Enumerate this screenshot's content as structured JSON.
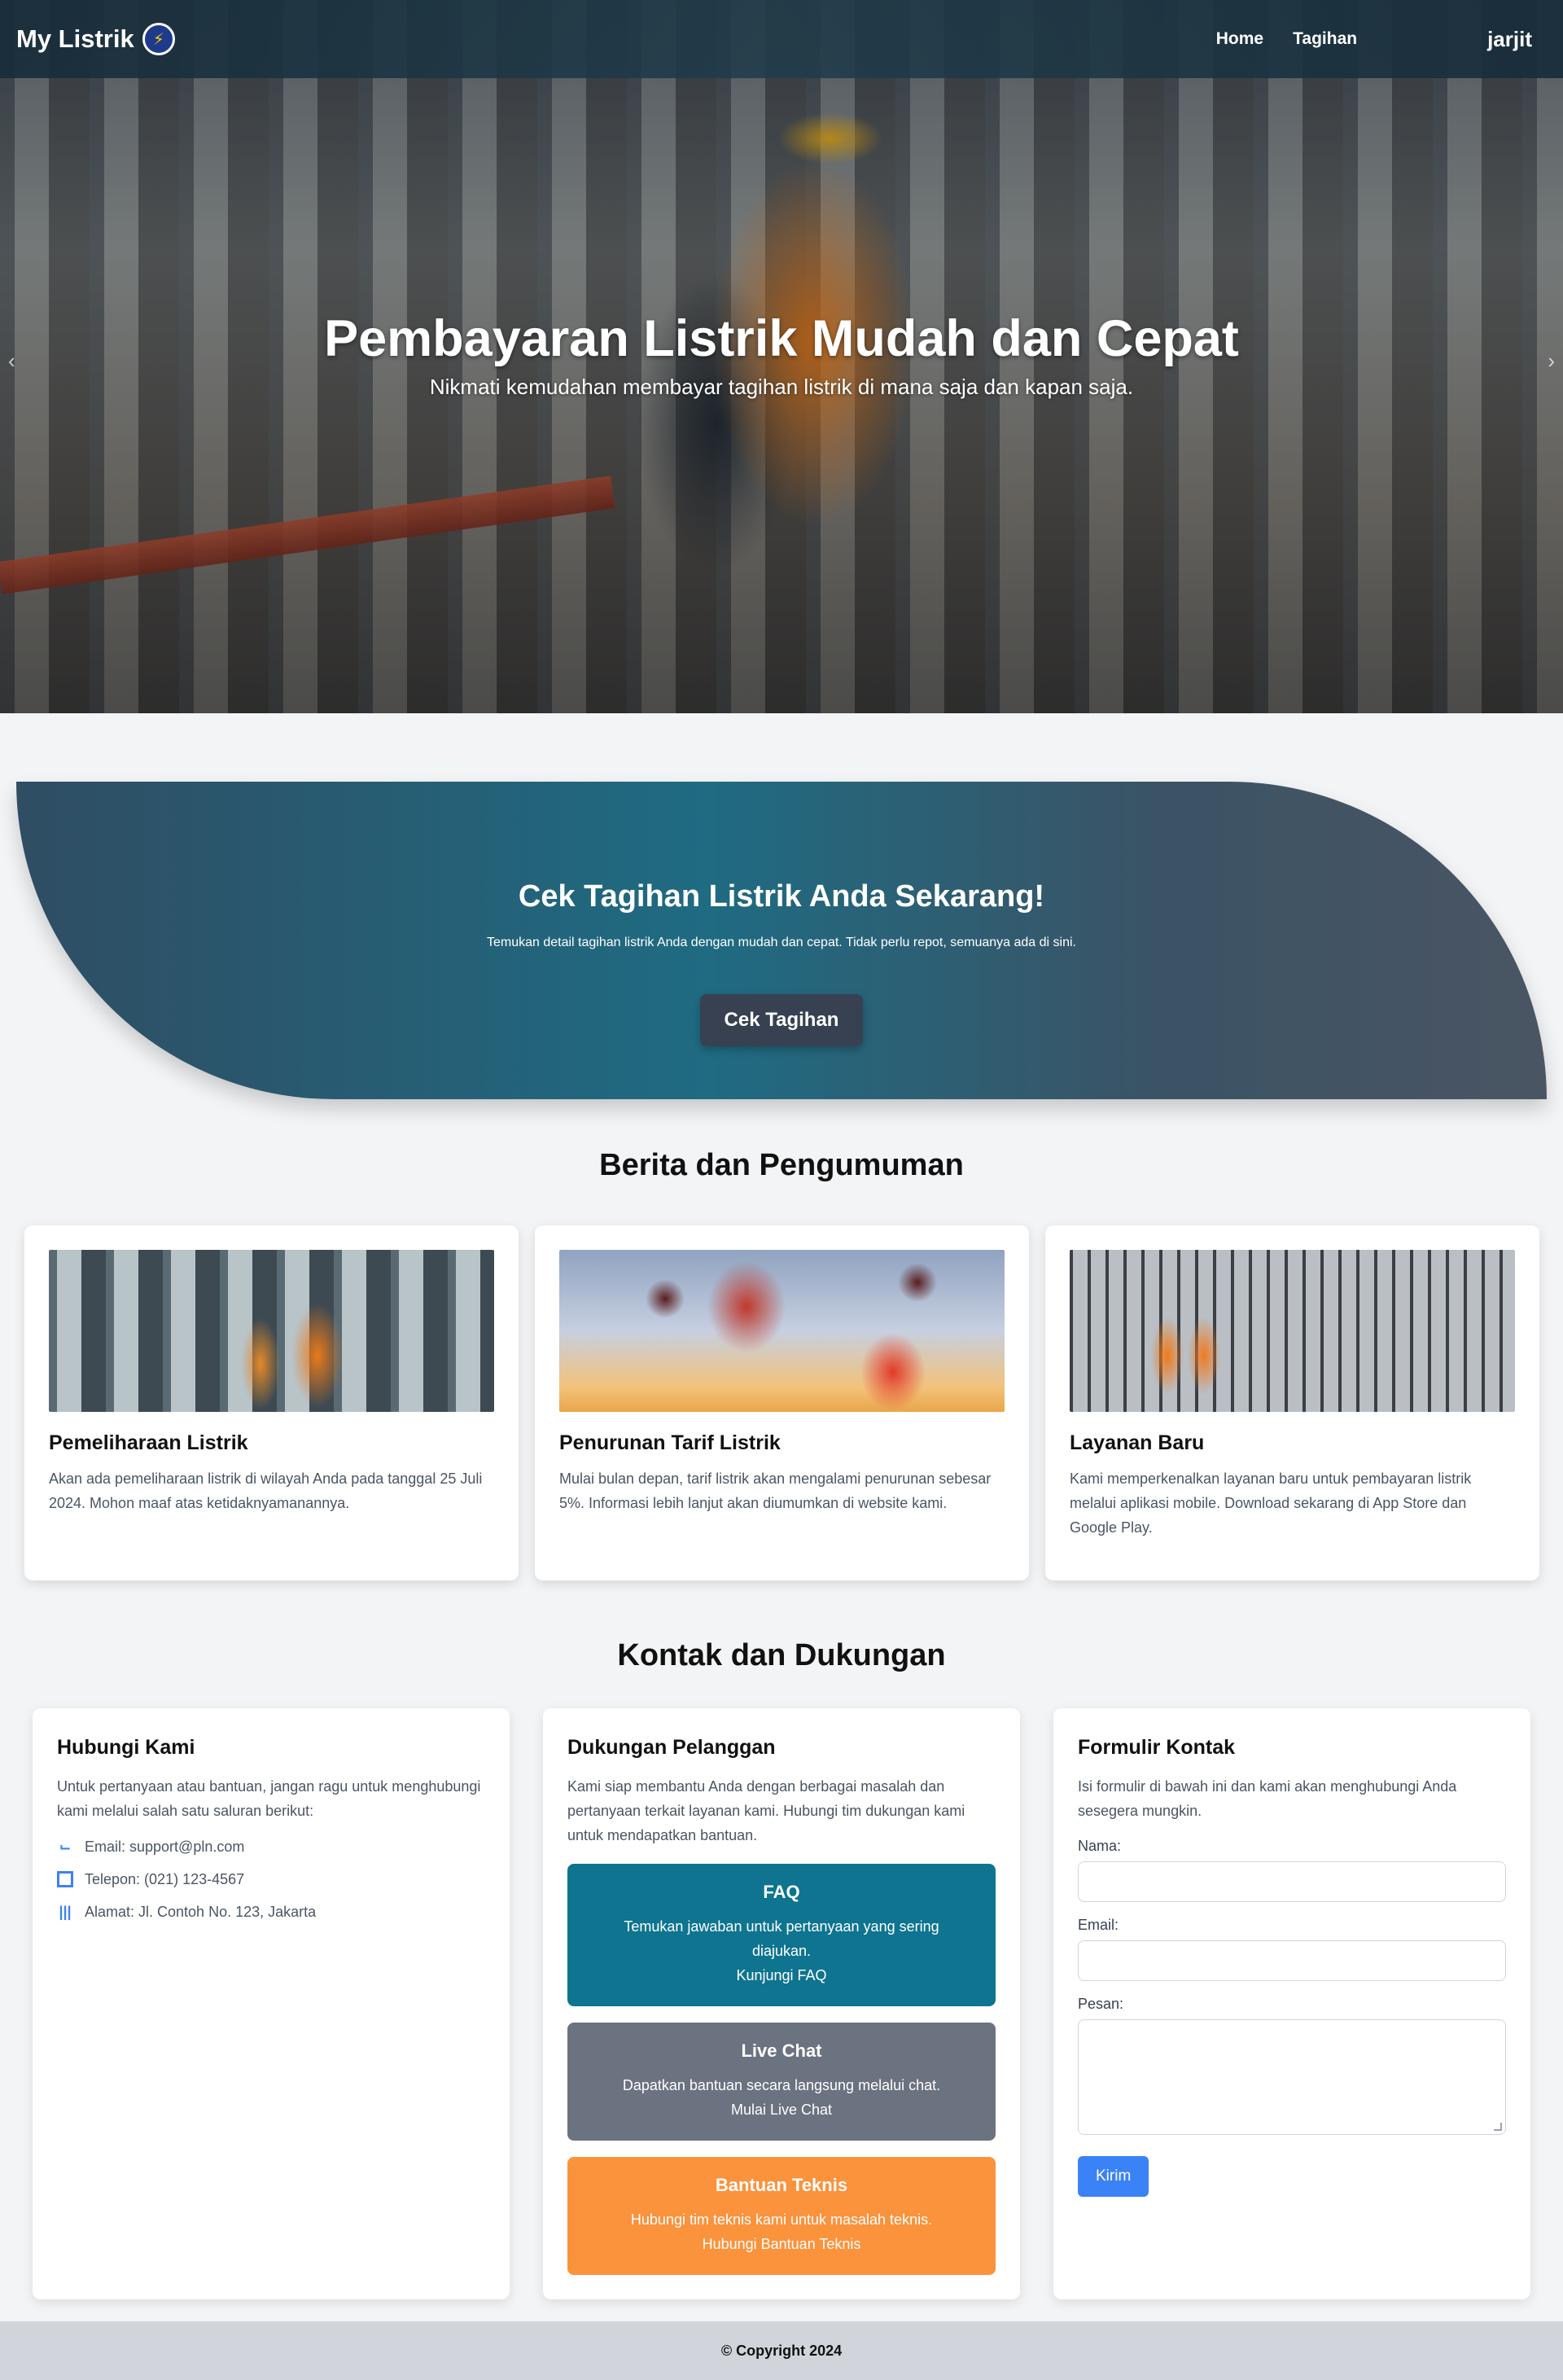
{
  "navbar": {
    "brand": "My Listrik",
    "brand_icon": "lightning-icon",
    "links": [
      {
        "label": "Home"
      },
      {
        "label": "Tagihan"
      }
    ],
    "user": "jarjit"
  },
  "hero": {
    "title": "Pembayaran Listrik Mudah dan Cepat",
    "subtitle": "Nikmati kemudahan membayar tagihan listrik di mana saja dan kapan saja.",
    "prev_icon": "‹",
    "next_icon": "›"
  },
  "cta": {
    "title": "Cek Tagihan Listrik Anda Sekarang!",
    "text": "Temukan detail tagihan listrik Anda dengan mudah dan cepat. Tidak perlu repot, semuanya ada di sini.",
    "button": "Cek Tagihan"
  },
  "news": {
    "title": "Berita dan Pengumuman",
    "items": [
      {
        "title": "Pemeliharaan Listrik",
        "text": "Akan ada pemeliharaan listrik di wilayah Anda pada tanggal 25 Juli 2024. Mohon maaf atas ketidaknyamanannya."
      },
      {
        "title": "Penurunan Tarif Listrik",
        "text": "Mulai bulan depan, tarif listrik akan mengalami penurunan sebesar 5%. Informasi lebih lanjut akan diumumkan di website kami."
      },
      {
        "title": "Layanan Baru",
        "text": "Kami memperkenalkan layanan baru untuk pembayaran listrik melalui aplikasi mobile. Download sekarang di App Store dan Google Play."
      }
    ]
  },
  "contact": {
    "title": "Kontak dan Dukungan",
    "reach": {
      "title": "Hubungi Kami",
      "text": "Untuk pertanyaan atau bantuan, jangan ragu untuk menghubungi kami melalui salah satu saluran berikut:",
      "email": "Email: support@pln.com",
      "phone": "Telepon: (021) 123-4567",
      "address": "Alamat: Jl. Contoh No. 123, Jakarta"
    },
    "support": {
      "title": "Dukungan Pelanggan",
      "text": "Kami siap membantu Anda dengan berbagai masalah dan pertanyaan terkait layanan kami. Hubungi tim dukungan kami untuk mendapatkan bantuan.",
      "faq": {
        "title": "FAQ",
        "text": "Temukan jawaban untuk pertanyaan yang sering diajukan.",
        "link": "Kunjungi FAQ"
      },
      "chat": {
        "title": "Live Chat",
        "text": "Dapatkan bantuan secara langsung melalui chat.",
        "link": "Mulai Live Chat"
      },
      "tech": {
        "title": "Bantuan Teknis",
        "text": "Hubungi tim teknis kami untuk masalah teknis.",
        "link": "Hubungi Bantuan Teknis"
      }
    },
    "form": {
      "title": "Formulir Kontak",
      "text": "Isi formulir di bawah ini dan kami akan menghubungi Anda sesegera mungkin.",
      "name_label": "Nama:",
      "email_label": "Email:",
      "message_label": "Pesan:",
      "submit": "Kirim"
    }
  },
  "footer": {
    "text": "© Copyright 2024"
  },
  "colors": {
    "faq": "#0e7490",
    "chat": "#6b7280",
    "tech": "#fb923c",
    "primary": "#3b82f6",
    "button_dark": "#374151"
  }
}
